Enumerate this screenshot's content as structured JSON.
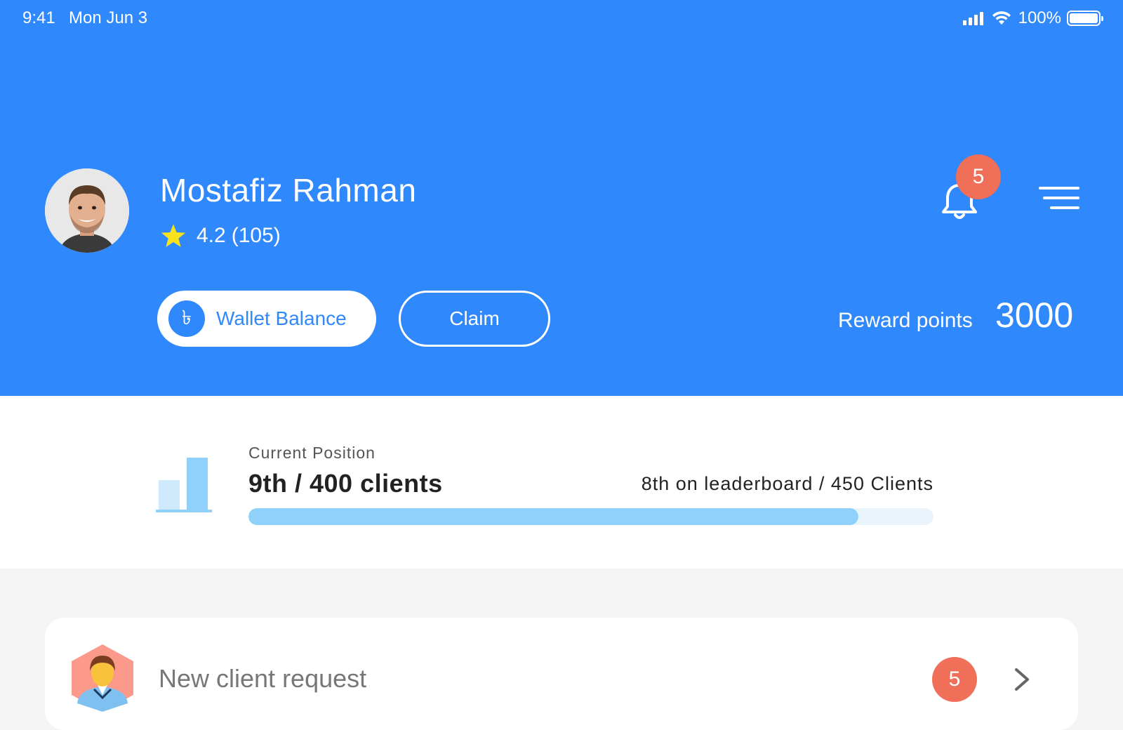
{
  "status_bar": {
    "time": "9:41",
    "date": "Mon Jun 3",
    "battery": "100%"
  },
  "profile": {
    "name": "Mostafiz Rahman",
    "rating": "4.2",
    "rating_count": "(105)"
  },
  "notifications": {
    "count": "5"
  },
  "wallet": {
    "label": "Wallet Balance",
    "currency_symbol": "৳"
  },
  "claim": {
    "label": "Claim"
  },
  "reward": {
    "label": "Reward points",
    "value": "3000"
  },
  "position": {
    "label": "Current Position",
    "value": "9th / 400 clients",
    "leaderboard": "8th on leaderboard / 450 Clients",
    "progress_percent": 89
  },
  "request": {
    "label": "New client request",
    "count": "5"
  },
  "colors": {
    "primary": "#3088fd",
    "badge": "#f06f58",
    "progress": "#8fd1fa",
    "progress_track": "#eaf4fc",
    "star": "#f7e21b"
  }
}
